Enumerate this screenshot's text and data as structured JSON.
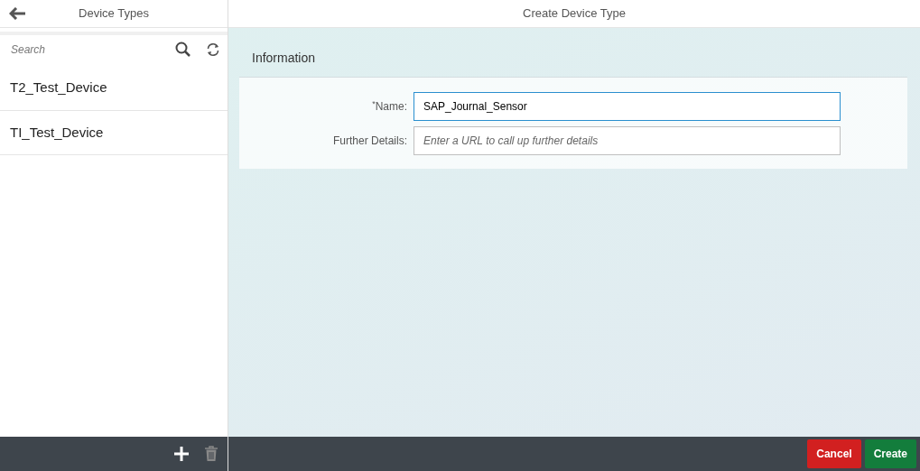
{
  "master": {
    "title": "Device Types",
    "search": {
      "placeholder": "Search"
    },
    "items": [
      {
        "label": "T2_Test_Device",
        "selected": false
      },
      {
        "label": "TI_Test_Device",
        "selected": false
      }
    ],
    "footer": {
      "add_disabled": false,
      "delete_disabled": true
    }
  },
  "detail": {
    "title": "Create Device Type",
    "section": "Information",
    "fields": [
      {
        "label": "$^{*}$Name:",
        "value": "SAP_Journal_Sensor",
        "focused": true
      },
      {
        "label": "Further Details:",
        "placeholder": "Enter a URL to call up further details",
        "focused": false
      }
    ],
    "buttons": [
      {
        "label": "Cancel",
        "kind": "reject"
      },
      {
        "label": "Create",
        "kind": "accept"
      }
    ]
  }
}
